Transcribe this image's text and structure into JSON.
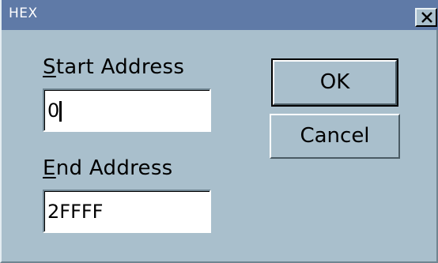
{
  "window": {
    "title": "HEX",
    "close_glyph": "✕"
  },
  "start_address": {
    "label_mnemonic": "S",
    "label_rest": "tart Address",
    "value": "0"
  },
  "end_address": {
    "label_mnemonic": "E",
    "label_rest": "nd Address",
    "value": "2FFFF"
  },
  "buttons": {
    "ok": "OK",
    "cancel": "Cancel"
  },
  "colors": {
    "titlebar": "#5f7aa7",
    "face": "#a9bfcc"
  }
}
